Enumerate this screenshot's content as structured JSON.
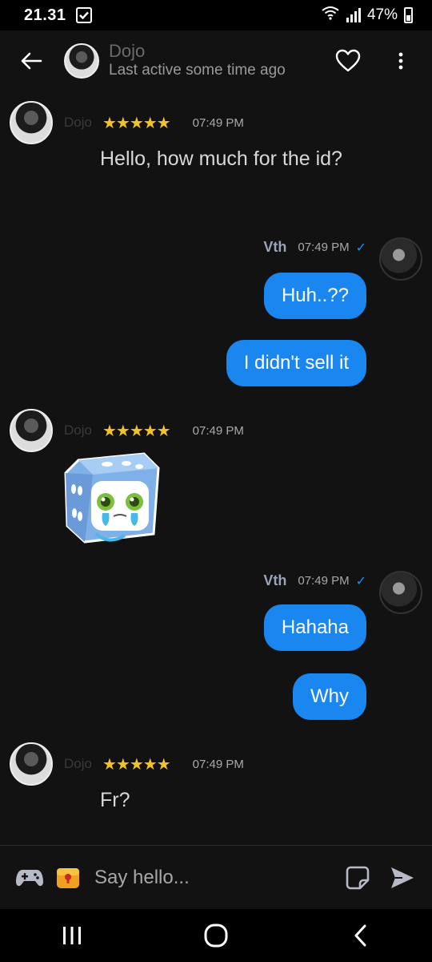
{
  "status_bar": {
    "time": "21.31",
    "battery": "47%",
    "icons": [
      "notification-check-icon",
      "wifi-icon",
      "signal-icon",
      "battery-icon"
    ]
  },
  "header": {
    "name": "Dojo",
    "subtitle": "Last active some time ago",
    "icons": [
      "back-arrow-icon",
      "heart-icon",
      "more-vert-icon"
    ]
  },
  "messages": [
    {
      "sender": "Dojo",
      "direction": "incoming",
      "rating": "★★★★★",
      "time": "07:49 PM",
      "text": "Hello, how much for the id?"
    },
    {
      "sender": "Vth",
      "direction": "outgoing",
      "time": "07:49 PM",
      "bubbles": [
        "Huh..??",
        "I didn't sell it"
      ]
    },
    {
      "sender": "Dojo",
      "direction": "incoming",
      "rating": "★★★★★",
      "time": "07:49 PM",
      "sticker": "crying-dice-sticker"
    },
    {
      "sender": "Vth",
      "direction": "outgoing",
      "time": "07:49 PM",
      "bubbles": [
        "Hahaha",
        "Why"
      ]
    },
    {
      "sender": "Dojo",
      "direction": "incoming",
      "rating": "★★★★★",
      "time": "07:49 PM",
      "text": "Fr?"
    }
  ],
  "composer": {
    "placeholder": "Say hello...",
    "icons": [
      "game-controller-icon",
      "gift-box-icon",
      "sticker-icon",
      "send-icon"
    ]
  },
  "nav_bar": {
    "icons": [
      "recent-apps-icon",
      "home-icon",
      "back-icon"
    ]
  },
  "colors": {
    "background": "#121212",
    "bubble": "#1a86f0",
    "stars": "#f2c12e",
    "check": "#1c8ef9"
  }
}
